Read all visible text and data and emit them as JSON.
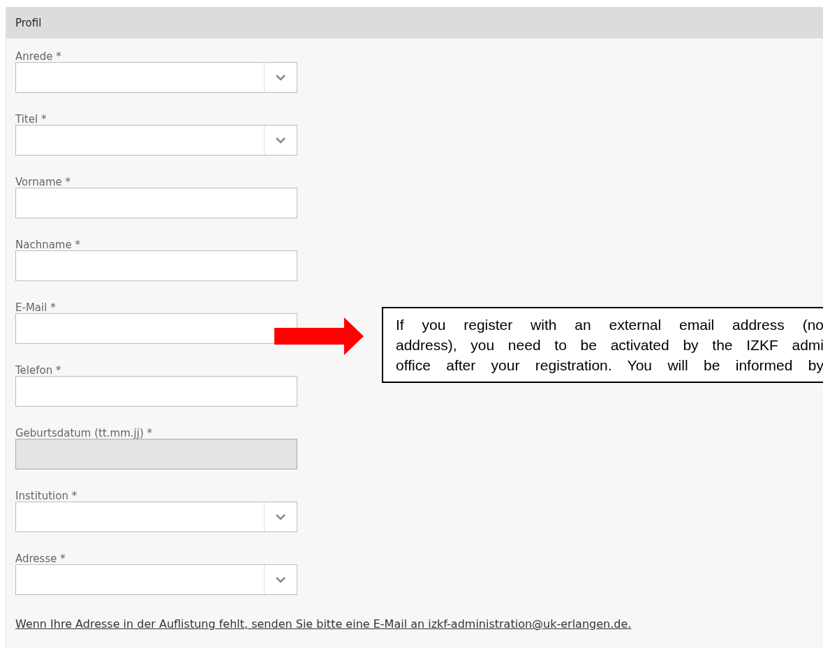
{
  "panel": {
    "title": "Profil"
  },
  "fields": [
    {
      "label": "Anrede *",
      "kind": "select",
      "disabled": false
    },
    {
      "label": "Titel *",
      "kind": "select",
      "disabled": false
    },
    {
      "label": "Vorname *",
      "kind": "text",
      "disabled": false
    },
    {
      "label": "Nachname *",
      "kind": "text",
      "disabled": false
    },
    {
      "label": "E-Mail *",
      "kind": "text",
      "disabled": false
    },
    {
      "label": "Telefon *",
      "kind": "text",
      "disabled": false
    },
    {
      "label": "Geburtsdatum (tt.mm.jj) *",
      "kind": "text",
      "disabled": true
    },
    {
      "label": "Institution *",
      "kind": "select",
      "disabled": false
    },
    {
      "label": "Adresse *",
      "kind": "select",
      "disabled": false
    }
  ],
  "callout": {
    "lines": [
      "If you register with an external email address (no",
      "address), you need to be activated by the IZKF admi",
      "office after your registration. You will be informed by"
    ]
  },
  "contact_link": "Wenn Ihre Adresse in der Auflistung fehlt, senden Sie bitte eine E-Mail an izkf-administration@uk-erlangen.de."
}
